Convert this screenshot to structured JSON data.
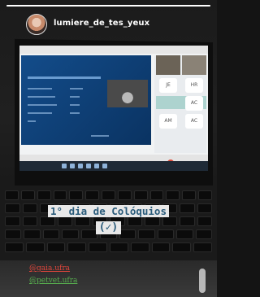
{
  "story": {
    "username": "lumiere_de_tes_yeux",
    "progress": 1.0
  },
  "caption": {
    "line1": "1° dia de Colóquios",
    "line2": "(✓)"
  },
  "mentions": [
    "@gaia.ufra",
    "@petvet.ufra"
  ],
  "meet": {
    "tiles": [
      "JE",
      "HR",
      "AC",
      "AM",
      "AC"
    ]
  },
  "colors": {
    "caption_text": "#2a5b7a",
    "caption_bg": "#e8e8e8",
    "mention1": "#e0463c",
    "mention2": "#58b34f"
  }
}
